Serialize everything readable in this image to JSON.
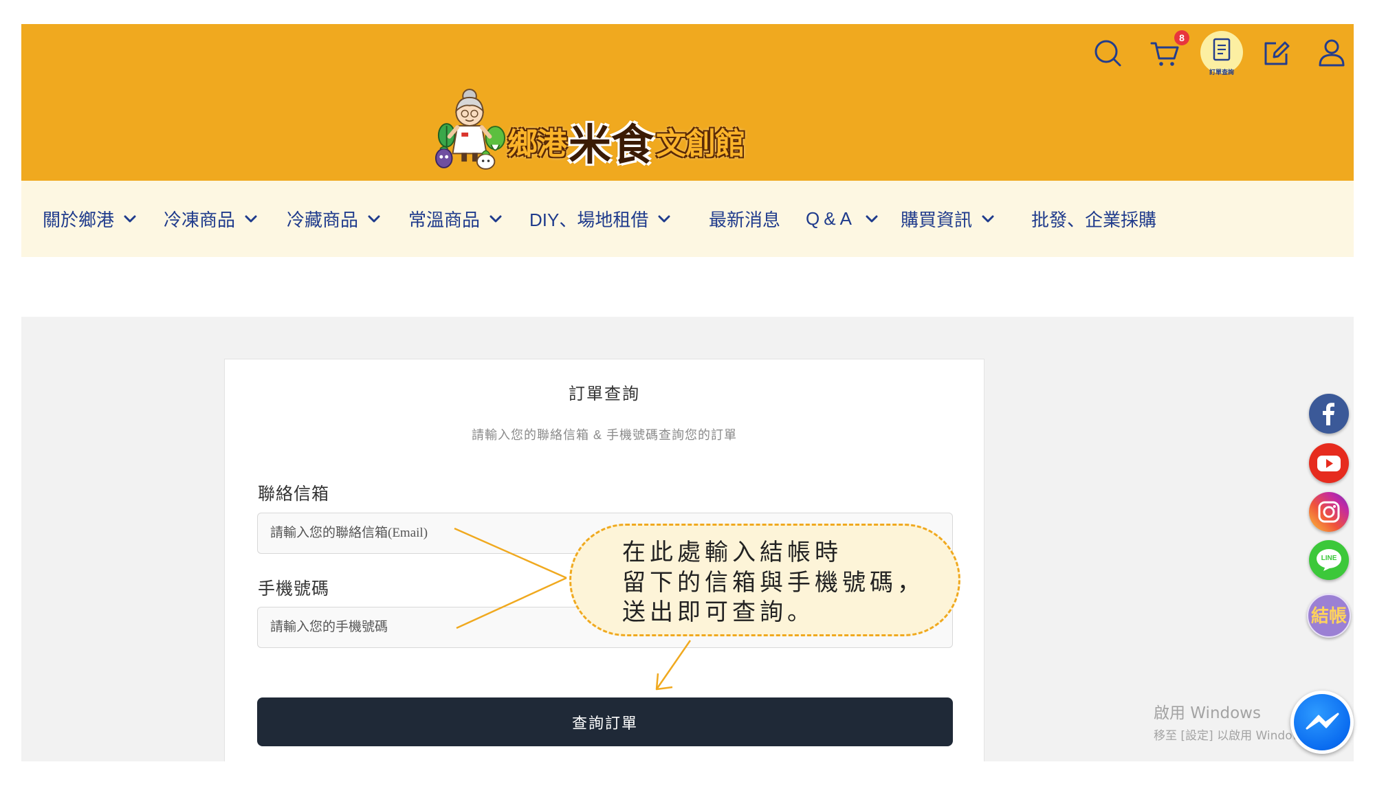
{
  "header": {
    "logo": {
      "name_left": "鄉港",
      "name_center": "米食",
      "name_right": "文創館"
    },
    "icons": {
      "search": "search-icon",
      "cart": "cart-icon",
      "order_query": "order-document-icon",
      "edit": "edit-icon",
      "user": "user-icon"
    },
    "cart_badge": "8",
    "order_query_label": "訂單查詢",
    "colors": {
      "background": "#f0a91f",
      "icon": "#233d8c",
      "badge": "#e8363d",
      "order_query_highlight": "#fcefa2"
    }
  },
  "nav": {
    "items": [
      {
        "label": "關於鄉港",
        "has_dropdown": true
      },
      {
        "label": "冷凍商品",
        "has_dropdown": true
      },
      {
        "label": "冷藏商品",
        "has_dropdown": true
      },
      {
        "label": "常溫商品",
        "has_dropdown": true
      },
      {
        "label": "DIY、場地租借",
        "has_dropdown": true
      },
      {
        "label": "最新消息",
        "has_dropdown": false
      },
      {
        "label": "Q&A",
        "has_dropdown": true
      },
      {
        "label": "購買資訊",
        "has_dropdown": true
      },
      {
        "label": "批發、企業採購",
        "has_dropdown": false
      }
    ],
    "colors": {
      "background": "#fdf7e2",
      "text": "#1f3b8c"
    }
  },
  "order_form": {
    "title": "訂單查詢",
    "subtitle": "請輸入您的聯絡信箱 & 手機號碼查詢您的訂單",
    "email": {
      "label": "聯絡信箱",
      "placeholder": "請輸入您的聯絡信箱(Email)",
      "value": ""
    },
    "phone": {
      "label": "手機號碼",
      "placeholder": "請輸入您的手機號碼",
      "value": ""
    },
    "submit_label": "查詢訂單",
    "colors": {
      "section_background": "#f2f2f2",
      "card_background": "#ffffff",
      "button": "#1f2937",
      "button_text": "#ffffff"
    }
  },
  "annotation": {
    "lines": [
      "在此處輸入結帳時",
      "留下的信箱與手機號碼，",
      "送出即可查詢。"
    ],
    "colors": {
      "border": "#f0a91f",
      "fill": "#fdf4d8",
      "arrow": "#f0a91f"
    }
  },
  "floating_sidebar": {
    "buttons": [
      {
        "icon": "facebook-icon",
        "color": "#3b5998"
      },
      {
        "icon": "youtube-icon",
        "color": "#e62b1e"
      },
      {
        "icon": "instagram-icon",
        "color": "#d6249f"
      },
      {
        "icon": "line-icon",
        "color": "#3cc83a",
        "text": "LINE"
      },
      {
        "color": "#9b80d4",
        "text": "結帳"
      }
    ],
    "messenger": {
      "icon": "messenger-icon",
      "color": "#0a7cff"
    }
  },
  "os_watermark": {
    "title": "啟用 Windows",
    "message": "移至 [設定] 以啟用 Windows"
  }
}
